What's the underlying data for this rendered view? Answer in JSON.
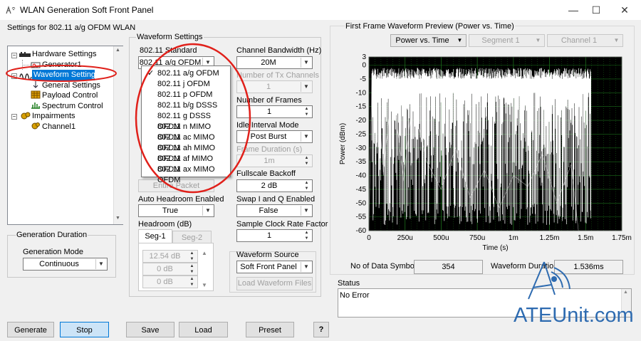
{
  "window": {
    "title": "WLAN Generation Soft Front Panel",
    "controls": {
      "minimize": "—",
      "maximize": "☐",
      "close": "✕"
    }
  },
  "settings_panel": {
    "label": "Settings for 802.11 a/g OFDM WLAN",
    "tree": [
      "Hardware Settings",
      "Generator1",
      "Waveform Settings",
      "General Settings",
      "Payload Control",
      "Spectrum Control",
      "Impairments",
      "Channel1"
    ]
  },
  "generation_duration": {
    "label": "Generation Duration",
    "mode_label": "Generation Mode",
    "mode_value": "Continuous"
  },
  "waveform_settings": {
    "label": "Waveform Settings",
    "standard_label": "802.11 Standard",
    "standard_value": "802.11 a/g OFDM",
    "standard_options": [
      "802.11 a/g OFDM",
      "802.11 j OFDM",
      "802.11 p OFDM",
      "802.11 b/g DSSS",
      "802.11 g DSSS OFDM",
      "802.11 n MIMO OFDM",
      "802.11 ac MIMO OFDM",
      "802.11 ah MIMO OFDM",
      "802.11 af MIMO OFDM",
      "802.11 ax MIMO OFDM"
    ],
    "selected_check": "✓",
    "entire_packet": "Entire Packet",
    "auto_headroom_label": "Auto Headroom Enabled",
    "auto_headroom_value": "True",
    "headroom_label": "Headroom (dB)",
    "tabs": [
      "Seg-1",
      "Seg-2"
    ],
    "headroom_values": [
      "12.54 dB",
      "0 dB",
      "0 dB"
    ],
    "channel_bw_label": "Channel Bandwidth (Hz)",
    "channel_bw_value": "20M",
    "num_tx_label": "Number of Tx Channels",
    "num_tx_value": "1",
    "num_frames_label": "Number of Frames",
    "num_frames_value": "1",
    "idle_mode_label": "Idle Interval Mode",
    "idle_mode_value": "Post Burst",
    "frame_duration_label": "Frame Duration (s)",
    "frame_duration_value": "1m",
    "fullscale_label": "Fullscale Backoff",
    "fullscale_value": "2 dB",
    "swap_iq_label": "Swap I and Q Enabled",
    "swap_iq_value": "False",
    "sample_clock_label": "Sample Clock Rate Factor",
    "sample_clock_value": "1",
    "source_label": "Waveform Source",
    "source_value": "Soft Front Panel",
    "load_waveform_files": "Load Waveform Files"
  },
  "preview": {
    "label": "First Frame Waveform Preview (Power vs. Time)",
    "view_select": "Power vs. Time",
    "segment_select": "Segment 1",
    "channel_select": "Channel 1",
    "num_symbols_label": "No of Data Symbols",
    "num_symbols_value": "354",
    "duration_label": "Waveform Duration",
    "duration_value": "1.536ms"
  },
  "status": {
    "label": "Status",
    "text": "No Error"
  },
  "buttons": {
    "generate": "Generate",
    "stop": "Stop",
    "save": "Save",
    "load": "Load",
    "preset": "Preset",
    "help": "?"
  },
  "watermark": "ATEUnit.com",
  "chart_data": {
    "type": "line",
    "xlabel": "Time (s)",
    "ylabel": "Power (dBm)",
    "xlim": [
      0,
      0.00175
    ],
    "ylim": [
      -60,
      3
    ],
    "x_ticks": [
      "0",
      "250u",
      "500u",
      "750u",
      "1m",
      "1.25m",
      "1.5m",
      "1.75m"
    ],
    "y_ticks": [
      "3",
      "0",
      "-5",
      "-10",
      "-15",
      "-20",
      "-25",
      "-30",
      "-35",
      "-40",
      "-45",
      "-50",
      "-55",
      "-60"
    ],
    "grid": true,
    "colors": {
      "background": "#000000",
      "grid": "#1a6b1a",
      "trace": "#ffffff"
    },
    "series": [
      {
        "x": [
          0,
          2e-05,
          4e-05,
          6e-05,
          0.0001,
          0.00016,
          0.00024,
          0.0003,
          0.0004,
          0.0005,
          0.0006,
          0.0007,
          0.0008,
          0.0009,
          0.001,
          0.0011,
          0.0012,
          0.0013,
          0.0014,
          0.00145,
          0.0015,
          0.00175
        ],
        "y": [
          -60,
          -3,
          -8,
          -5,
          -40,
          -6,
          -42,
          -12,
          -35,
          -45,
          -30,
          -48,
          -38,
          -52,
          -40,
          -44,
          -32,
          -50,
          -36,
          -60,
          -60,
          -60
        ]
      }
    ]
  }
}
